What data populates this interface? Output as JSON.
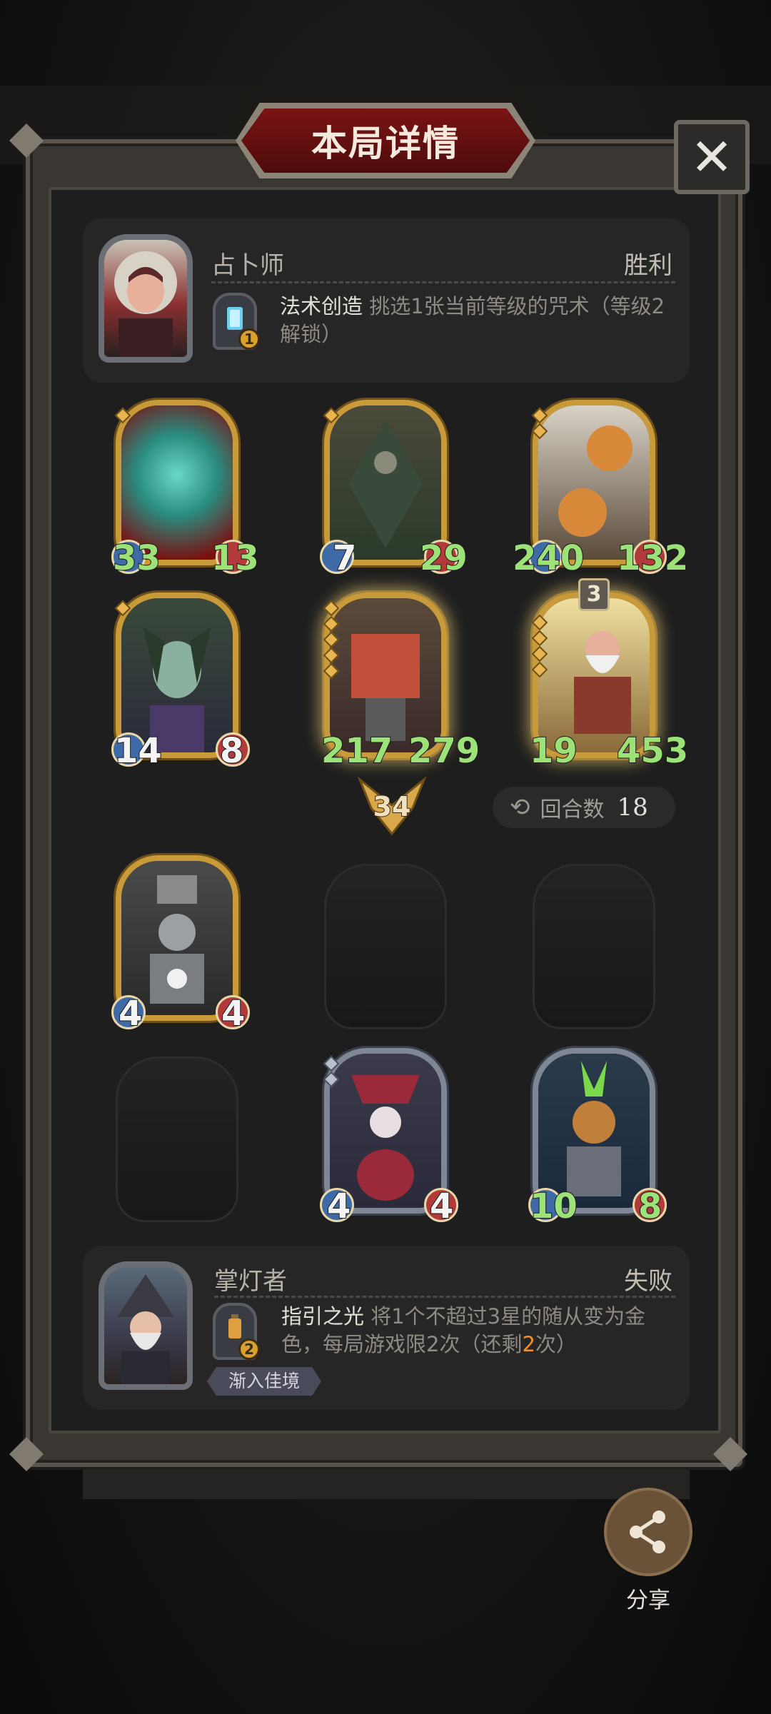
{
  "title": "本局详情",
  "close": "✕",
  "top_player": {
    "hero": "占卜师",
    "result": "胜利",
    "power_level": "1",
    "power_name": "法术创造",
    "power_desc": "挑选1张当前等级的咒术（等级2解锁）"
  },
  "top_cards": [
    {
      "atk": "33",
      "hp": "13",
      "gems": 1
    },
    {
      "atk": "7",
      "hp": "29",
      "gems": 1
    },
    {
      "atk": "240",
      "hp": "132",
      "gems": 2
    },
    {
      "atk": "14",
      "hp": "8",
      "gems": 1
    },
    {
      "atk": "217",
      "hp": "279",
      "gems": 5
    },
    {
      "atk": "19",
      "hp": "453",
      "gems": 4,
      "badge": "3"
    }
  ],
  "battle": {
    "damage": "34",
    "rounds_label": "回合数",
    "rounds": "18"
  },
  "bottom_cards": [
    {
      "atk": "4",
      "hp": "4"
    },
    {
      "atk": "4",
      "hp": "4"
    },
    {
      "atk": "10",
      "hp": "8"
    }
  ],
  "bottom_player": {
    "hero": "掌灯者",
    "result": "失败",
    "power_level": "2",
    "power_name": "指引之光",
    "power_desc_1": "将1个不超过3星的随从变为金",
    "power_desc_2a": "色，每局游戏限2次（还剩",
    "power_desc_remain": "2",
    "power_desc_2b": "次）",
    "tag": "渐入佳境"
  },
  "share_label": "分享",
  "colors": {
    "gold": "#c99a3a",
    "silver": "#7f8696",
    "stat_green": "#9ce278",
    "title_red": "#7a1414"
  }
}
